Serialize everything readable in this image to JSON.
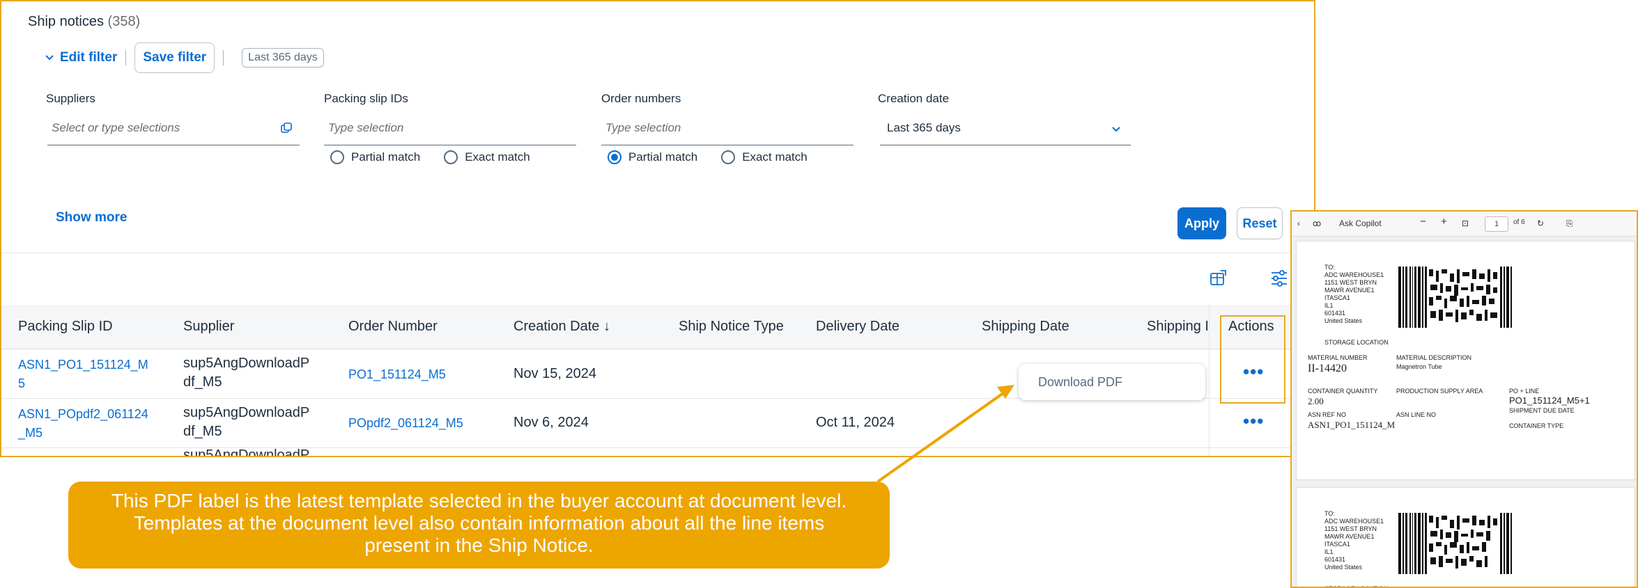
{
  "header": {
    "title": "Ship notices",
    "count": "(358)"
  },
  "toolbar": {
    "edit_filter": "Edit filter",
    "save_filter": "Save filter",
    "period_chip": "Last 365 days"
  },
  "filters": {
    "suppliers": {
      "label": "Suppliers",
      "placeholder": "Select or type selections"
    },
    "packing_slip": {
      "label": "Packing slip IDs",
      "placeholder": "Type selection",
      "partial": "Partial match",
      "exact": "Exact match",
      "selected": "none"
    },
    "order_numbers": {
      "label": "Order numbers",
      "placeholder": "Type selection",
      "partial": "Partial match",
      "exact": "Exact match",
      "selected": "partial"
    },
    "creation_date": {
      "label": "Creation date",
      "value": "Last 365 days"
    }
  },
  "actions": {
    "show_more": "Show more",
    "apply": "Apply",
    "reset": "Reset"
  },
  "table": {
    "columns": [
      "Packing Slip ID",
      "Supplier",
      "Order Number",
      "Creation Date ↓",
      "Ship Notice Type",
      "Delivery Date",
      "Shipping Date",
      "Shipping I",
      "Actions"
    ],
    "rows": [
      {
        "packing_slip_id_1": "ASN1_PO1_151124_M",
        "packing_slip_id_2": "5",
        "supplier_1": "sup5AngDownloadP",
        "supplier_2": "df_M5",
        "order_number": "PO1_151124_M5",
        "creation_date": "Nov 15, 2024",
        "delivery_date": ""
      },
      {
        "packing_slip_id_1": "ASN1_POpdf2_061124",
        "packing_slip_id_2": "_M5",
        "supplier_1": "sup5AngDownloadP",
        "supplier_2": "df_M5",
        "order_number": "POpdf2_061124_M5",
        "creation_date": "Nov 6, 2024",
        "delivery_date": "Oct 11, 2024"
      },
      {
        "partial_supplier": "sup5AngDownloadP"
      }
    ]
  },
  "popover": {
    "download_pdf": "Download PDF"
  },
  "annotation": {
    "line1": "This PDF label is the latest template selected in the buyer account at document level.",
    "line2": "Templates at the document level also contain information about all the line items",
    "line3": "present in the Ship Notice.",
    "color": "#eda500"
  },
  "pdf_viewer": {
    "toolbar": {
      "copilot": "Ask Copilot",
      "minus": "−",
      "plus": "+",
      "page": "1",
      "of_pages": "of 6"
    },
    "label": {
      "to": "TO:",
      "addr1": "ADC WAREHOUSE1",
      "addr2": "1151 WEST BRYN",
      "addr3": "MAWR AVENUE1",
      "addr4": "ITASCA1",
      "addr5": "IL1",
      "addr6": "601431",
      "addr7": "United States",
      "storage": "STORAGE LOCATION",
      "material_number_label": "MATERIAL NUMBER",
      "material_number": "II-14420",
      "material_desc_label": "MATERIAL DESCRIPTION",
      "material_desc": "Magnetron Tube",
      "container_qty_label": "CONTAINER QUANTITY",
      "container_qty": "2.00",
      "prod_supply_label": "PRODUCTION SUPPLY AREA",
      "po_line_label": "PO + LINE",
      "po_line": "PO1_151124_M5+1",
      "ship_due_label": "SHIPMENT DUE DATE",
      "asn_ref_label": "ASN REF NO",
      "asn_ref": "ASN1_PO1_151124_M",
      "asn_line_label": "ASN LINE NO",
      "container_type_label": "CONTAINER TYPE"
    }
  }
}
